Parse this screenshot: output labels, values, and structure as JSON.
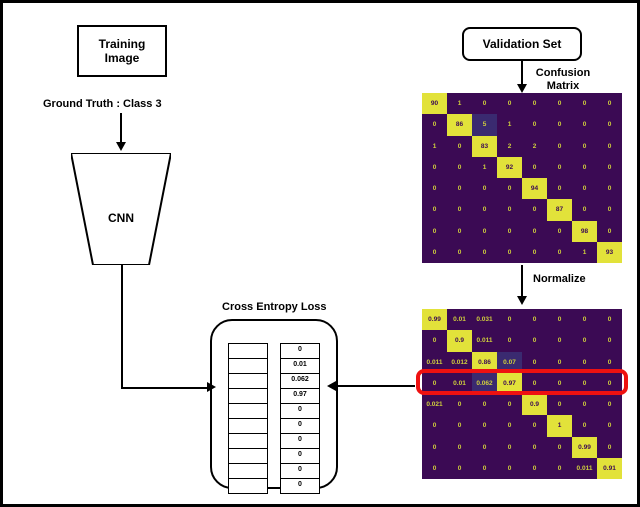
{
  "domain": "Diagram",
  "training_image_label": "Training\nImage",
  "ground_truth_text": "Ground Truth : Class 3",
  "cnn_label": "CNN",
  "validation_set_label": "Validation Set",
  "confusion_matrix_label": "Confusion\nMatrix",
  "normalize_label": "Normalize",
  "cross_entropy_label": "Cross Entropy Loss",
  "predictions_column": [
    "",
    "",
    "",
    "",
    "",
    "",
    "",
    "",
    "",
    ""
  ],
  "row_vector": [
    "0",
    "0.01",
    "0.062",
    "0.97",
    "0",
    "0",
    "0",
    "0",
    "0",
    "0"
  ],
  "highlighted_class_index": 3,
  "chart_data": [
    {
      "type": "heatmap",
      "name": "confusion_matrix_raw",
      "title": "Confusion Matrix",
      "size": [
        8,
        8
      ],
      "colormap": "viridis",
      "diag_color": "#e2e23a",
      "offdiag_color": "#3b0a54",
      "rows": [
        [
          90,
          1,
          0,
          0,
          0,
          0,
          0,
          0
        ],
        [
          0,
          86,
          5,
          1,
          0,
          0,
          0,
          0
        ],
        [
          1,
          0,
          83,
          2,
          2,
          0,
          0,
          0
        ],
        [
          0,
          0,
          1,
          92,
          0,
          0,
          0,
          0
        ],
        [
          0,
          0,
          0,
          0,
          94,
          0,
          0,
          0
        ],
        [
          0,
          0,
          0,
          0,
          0,
          87,
          0,
          0
        ],
        [
          0,
          0,
          0,
          0,
          0,
          0,
          98,
          0
        ],
        [
          0,
          0,
          0,
          0,
          0,
          0,
          1,
          93
        ]
      ]
    },
    {
      "type": "heatmap",
      "name": "confusion_matrix_normalized",
      "title": "Normalized Confusion Matrix",
      "size": [
        8,
        8
      ],
      "colormap": "viridis",
      "diag_color": "#e2e23a",
      "offdiag_color": "#3b0a54",
      "highlight_row": 3,
      "rows": [
        [
          0.99,
          0.01,
          0.031,
          0,
          0,
          0,
          0,
          0
        ],
        [
          0,
          0.9,
          0.011,
          0.0,
          0,
          0,
          0,
          0
        ],
        [
          0.011,
          0.012,
          0.86,
          0.07,
          0,
          0,
          0,
          0
        ],
        [
          0,
          0.01,
          0.062,
          0.97,
          0,
          0,
          0,
          0
        ],
        [
          0.021,
          0,
          0,
          0,
          0.9,
          0,
          0,
          0
        ],
        [
          0,
          0,
          0,
          0,
          0,
          1,
          0,
          0
        ],
        [
          0,
          0,
          0,
          0,
          0,
          0,
          0.99,
          0
        ],
        [
          0,
          0,
          0,
          0,
          0,
          0,
          0.011,
          0.91
        ]
      ]
    }
  ]
}
